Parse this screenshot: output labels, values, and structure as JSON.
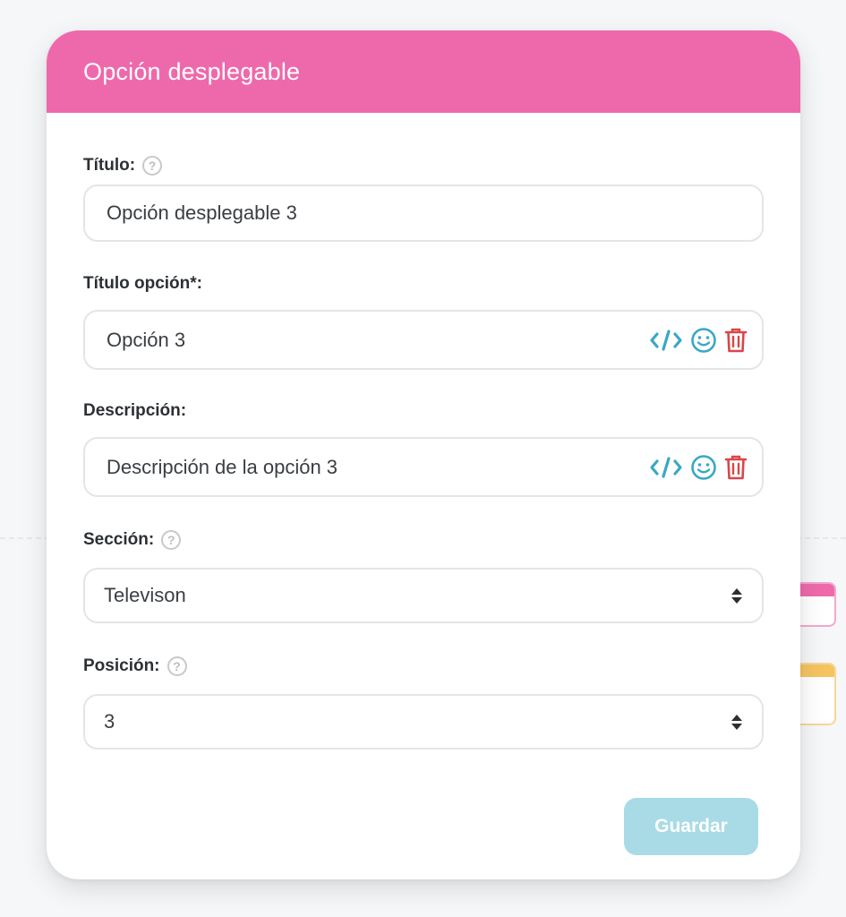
{
  "modal": {
    "title": "Opción desplegable",
    "header_color": "#ee69ab"
  },
  "fields": {
    "titulo": {
      "label": "Título:",
      "value": "Opción desplegable 3"
    },
    "titulo_opcion": {
      "label": "Título opción*:",
      "value": "Opción 3"
    },
    "descripcion": {
      "label": "Descripción:",
      "value": "Descripción de la opción 3"
    },
    "seccion": {
      "label": "Sección:",
      "selected": "Televison"
    },
    "posicion": {
      "label": "Posición:",
      "selected": "3"
    }
  },
  "icons": {
    "help": "?",
    "code": "code-icon",
    "emoji": "smiley-icon",
    "delete": "trash-icon"
  },
  "colors": {
    "code_icon": "#3aa7c9",
    "emoji_icon": "#3aa7c9",
    "delete_icon": "#d9464a",
    "save_button": "#a8dbe6"
  },
  "actions": {
    "save_label": "Guardar"
  }
}
